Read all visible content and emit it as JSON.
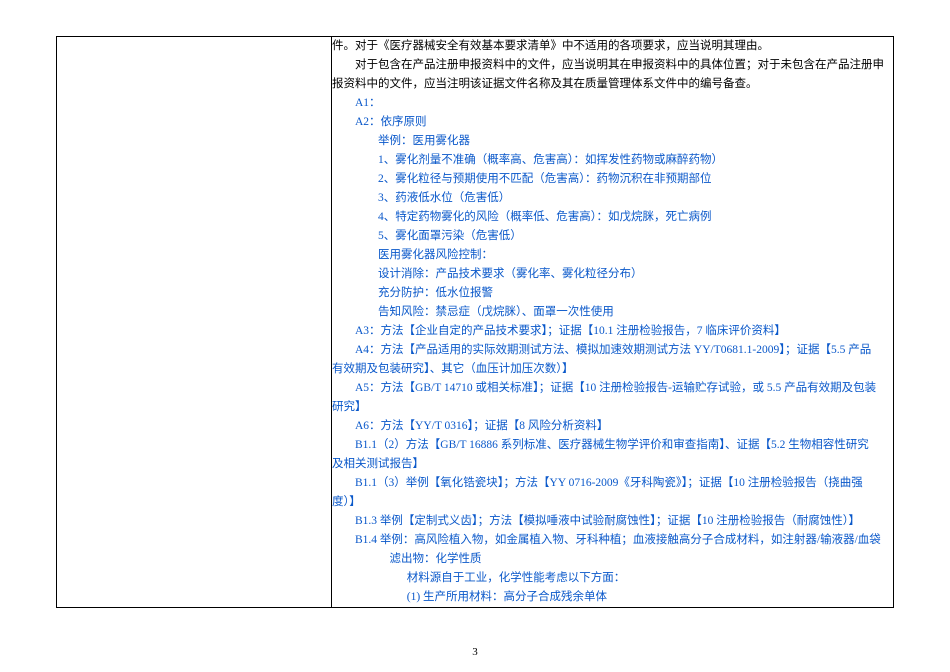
{
  "body": {
    "p1": "件。对于《医疗器械安全有效基本要求清单》中不适用的各项要求，应当说明其理由。",
    "p2a": "对于包含在产品注册申报资料中的文件，应当说明其在申报资料中的具体位置；对于未包含在产品注册申",
    "p2b": "报资料中的文件，应当注明该证据文件名称及其在质量管理体系文件中的编号备查。",
    "a1": "A1：",
    "a2": "A2：依序原则",
    "a2_ex": "举例：医用雾化器",
    "a2_1": "1、雾化剂量不准确（概率高、危害高）：如挥发性药物或麻醉药物）",
    "a2_2": "2、雾化粒径与预期使用不匹配（危害高）：药物沉积在非预期部位",
    "a2_3": "3、药液低水位（危害低）",
    "a2_4": "4、特定药物雾化的风险（概率低、危害高）：如戊烷脒，死亡病例",
    "a2_5": "5、雾化面罩污染（危害低）",
    "a2_ctrl": "医用雾化器风险控制：",
    "a2_c1": "设计消除：产品技术要求（雾化率、雾化粒径分布）",
    "a2_c2": "充分防护：低水位报警",
    "a2_c3": "告知风险：禁忌症（戊烷脒）、面罩一次性使用",
    "a3": "A3：方法【企业自定的产品技术要求】；证据【10.1 注册检验报告，7 临床评价资料】",
    "a4a": "A4：方法【产品适用的实际效期测试方法、模拟加速效期测试方法 YY/T0681.1-2009】；证据【5.5 产品",
    "a4b": "有效期及包装研究】、其它（血压计加压次数）】",
    "a5a": "A5：方法【GB/T 14710 或相关标准】；证据【10 注册检验报告-运输贮存试验，或 5.5 产品有效期及包装",
    "a5b": "研究】",
    "a6": "A6：方法【YY/T 0316】；证据【8 风险分析资料】",
    "b11a": "B1.1（2）方法【GB/T 16886 系列标准、医疗器械生物学评价和审查指南】、证据【5.2 生物相容性研究",
    "b11b": "及相关测试报告】",
    "b113a": "B1.1（3）举例【氧化锆瓷块】；方法【YY 0716-2009《牙科陶瓷》】；证据【10 注册检验报告（挠曲强",
    "b113b": "度）】",
    "b13": "B1.3 举例【定制式义齿】；方法【模拟唾液中试验耐腐蚀性】；证据【10 注册检验报告（耐腐蚀性）】",
    "b14": "B1.4 举例：高风险植入物，如金属植入物、牙科种植；血液接触高分子合成材料，如注射器/输液器/血袋",
    "b14_1": "滤出物：化学性质",
    "b14_2": "材料源自于工业，化学性能考虑以下方面：",
    "b14_3": "(1) 生产所用材料：高分子合成残余单体"
  },
  "pagenum": "3"
}
